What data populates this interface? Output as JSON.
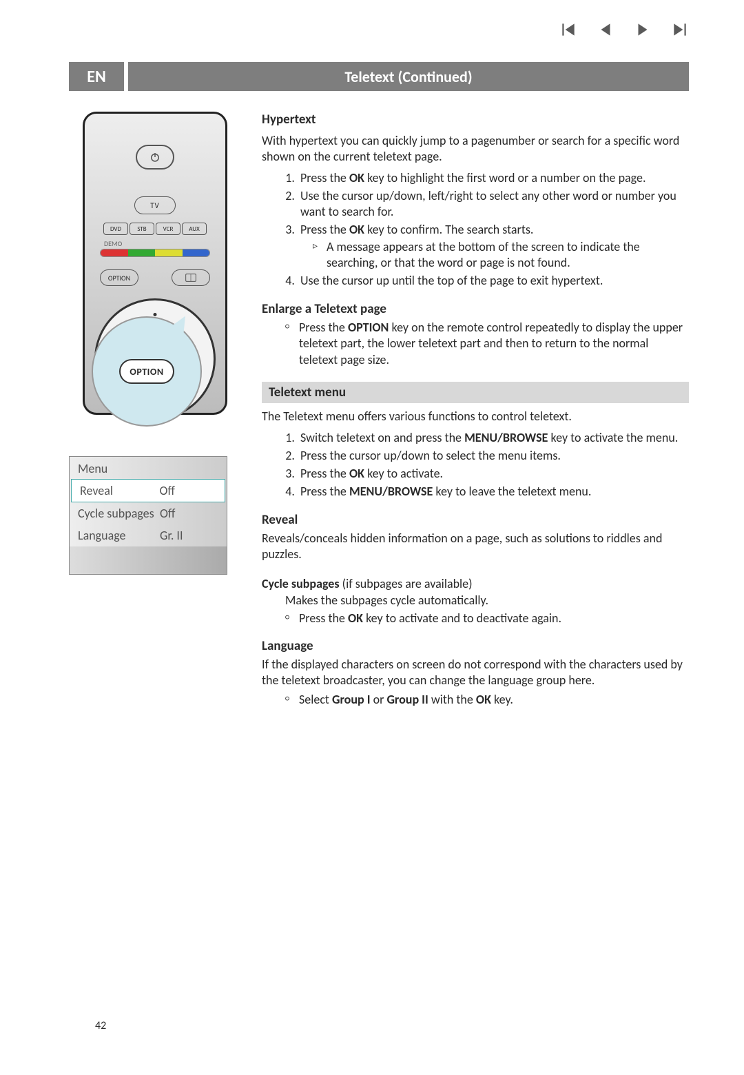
{
  "nav": {
    "first": "first-icon",
    "prev": "prev-icon",
    "next": "next-icon",
    "last": "last-icon"
  },
  "header": {
    "lang": "EN",
    "title": "Teletext  (Continued)"
  },
  "remote": {
    "tv": "TV",
    "modes": [
      "DVD",
      "STB",
      "VCR",
      "AUX"
    ],
    "demo": "DEMO",
    "option_small": "OPTION",
    "book": "book-icon",
    "callout": "OPTION"
  },
  "menu_table": {
    "header": "Menu",
    "rows": [
      {
        "k": "Reveal",
        "v": "Off",
        "sel": true
      },
      {
        "k": "Cycle subpages",
        "v": "Off",
        "sel": false
      },
      {
        "k": "Language",
        "v": "Gr. II",
        "sel": false
      }
    ]
  },
  "sections": {
    "hypertext": {
      "heading": "Hypertext",
      "intro": "With hypertext you can quickly jump to a pagenumber or search for a specific word shown on the current teletext page.",
      "steps": [
        {
          "pre": "Press the ",
          "bold": "OK",
          "post": " key to highlight the first word or a number on the page."
        },
        {
          "text": "Use the cursor up/down, left/right to select any other word or number you want to search for."
        },
        {
          "pre": "Press the ",
          "bold": "OK",
          "post": " key to confirm. The search starts.",
          "sub": "A message appears at the bottom of the screen to indicate the searching, or that the word or page is not found."
        },
        {
          "text": "Use the cursor up until the top of the page to exit hypertext."
        }
      ]
    },
    "enlarge": {
      "heading": "Enlarge a Teletext page",
      "bullet_pre": "Press the ",
      "bullet_bold": "OPTION",
      "bullet_post": " key on the remote control repeatedly to display the upper teletext part, the lower teletext part and then to return to the normal teletext page size."
    },
    "menu": {
      "bar": "Teletext menu",
      "intro": "The Teletext menu offers various functions to control teletext.",
      "steps": [
        {
          "pre": "Switch teletext on and press the ",
          "bold": "MENU/BROWSE",
          "post": " key to activate the menu."
        },
        {
          "text": "Press the cursor up/down to select the menu items."
        },
        {
          "pre": "Press the ",
          "bold": "OK",
          "post": " key to activate."
        },
        {
          "pre": "Press the ",
          "bold": "MENU/BROWSE",
          "post": " key to leave the teletext menu."
        }
      ],
      "reveal": {
        "h": "Reveal",
        "p": "Reveals/conceals hidden information on a page, such as solutions to riddles and puzzles."
      },
      "cycle": {
        "h": "Cycle subpages",
        "tail": " (if subpages are available)",
        "p": "Makes the subpages cycle automatically.",
        "bp": "Press the ",
        "bb": "OK",
        "ba": " key to activate and to deactivate again."
      },
      "language": {
        "h": "Language",
        "p": "If the displayed characters on screen do not correspond with the characters used by the teletext broadcaster, you can change the language group here.",
        "bp": "Select ",
        "bb1": "Group I",
        "mid": " or ",
        "bb2": "Group II",
        "ba": " with the ",
        "bb3": "OK",
        "end": " key."
      }
    }
  },
  "page_number": "42"
}
